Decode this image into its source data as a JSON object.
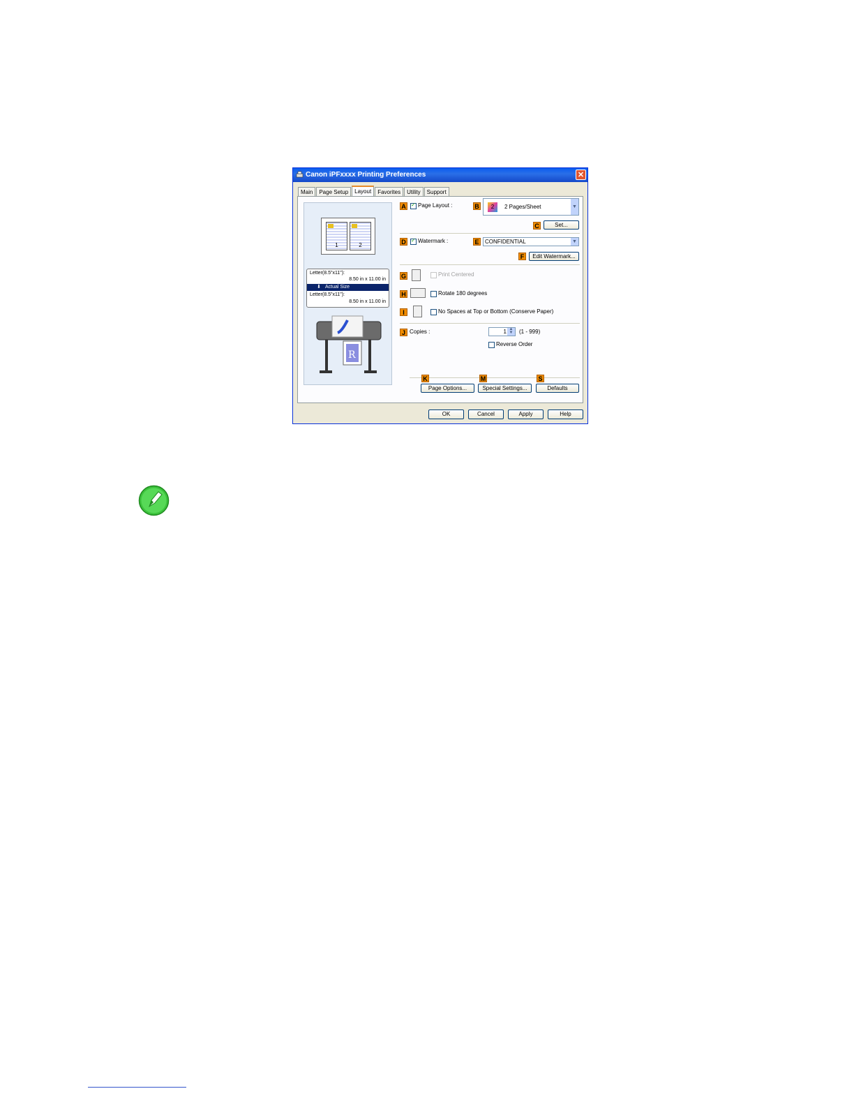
{
  "window": {
    "title": "Canon iPFxxxx Printing Preferences",
    "close": "✕"
  },
  "tabs": [
    "Main",
    "Page Setup",
    "Layout",
    "Favorites",
    "Utility",
    "Support"
  ],
  "preview": {
    "page1": "1",
    "page2": "2",
    "source_name": "Letter(8.5\"x11\"):",
    "source_size": "8.50 in x 11.00 in",
    "actual_size": "Actual Size",
    "output_name": "Letter(8.5\"x11\"):",
    "output_size": "8.50 in x 11.00 in"
  },
  "markers": {
    "a": "A",
    "b": "B",
    "c": "C",
    "d": "D",
    "e": "E",
    "f": "F",
    "g": "G",
    "h": "H",
    "i": "I",
    "j": "J",
    "k": "K",
    "m": "M",
    "s": "S"
  },
  "layout": {
    "page_layout_label": "Page Layout :",
    "page_layout_value": "2 Pages/Sheet",
    "page_layout_badge": "2",
    "set_button": "Set...",
    "watermark_label": "Watermark :",
    "watermark_value": "CONFIDENTIAL",
    "edit_watermark_button": "Edit Watermark...",
    "print_centered_label": "Print Centered",
    "rotate_label": "Rotate 180 degrees",
    "no_spaces_label": "No Spaces at Top or Bottom (Conserve Paper)",
    "copies_label": "Copies :",
    "copies_value": "1",
    "copies_range": "(1 - 999)",
    "reverse_order_label": "Reverse Order",
    "page_options_button": "Page Options...",
    "special_settings_button": "Special Settings...",
    "defaults_button": "Defaults"
  },
  "footer_buttons": {
    "ok": "OK",
    "cancel": "Cancel",
    "apply": "Apply",
    "help": "Help"
  }
}
